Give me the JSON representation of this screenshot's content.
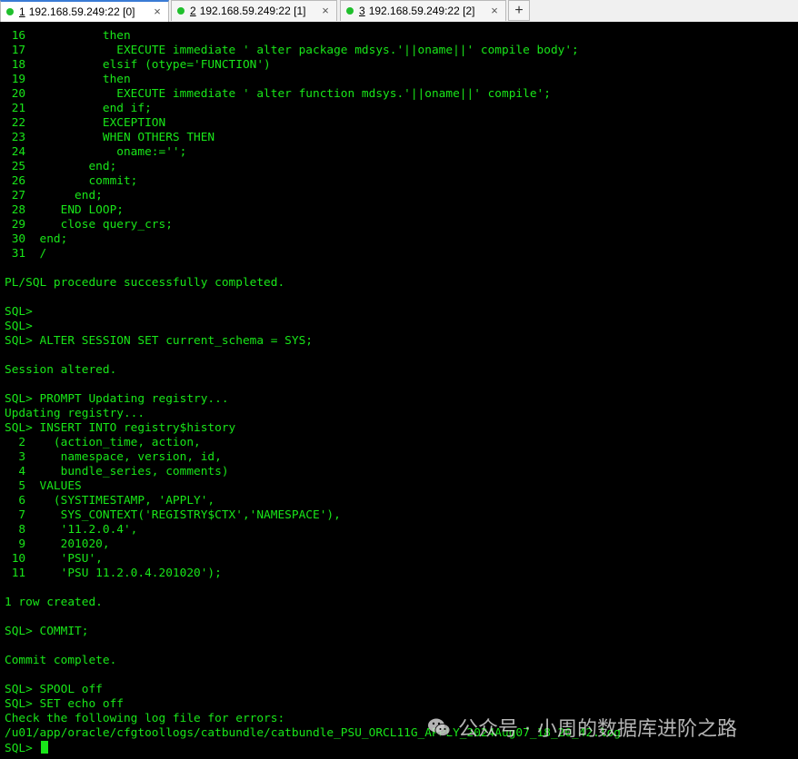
{
  "tabs": [
    {
      "num": "1",
      "label": "192.168.59.249:22 [0]",
      "active": true
    },
    {
      "num": "2",
      "label": "192.168.59.249:22 [1]",
      "active": false
    },
    {
      "num": "3",
      "label": "192.168.59.249:22 [2]",
      "active": false
    }
  ],
  "tab_add_label": "+",
  "tab_close_label": "×",
  "status_color": "#1fbf2c",
  "terminal": {
    "lines": [
      " 16           then",
      " 17             EXECUTE immediate ' alter package mdsys.'||oname||' compile body';",
      " 18           elsif (otype='FUNCTION')",
      " 19           then",
      " 20             EXECUTE immediate ' alter function mdsys.'||oname||' compile';",
      " 21           end if;",
      " 22           EXCEPTION",
      " 23           WHEN OTHERS THEN",
      " 24             oname:='';",
      " 25         end;",
      " 26         commit;",
      " 27       end;",
      " 28     END LOOP;",
      " 29     close query_crs;",
      " 30  end;",
      " 31  /",
      "",
      "PL/SQL procedure successfully completed.",
      "",
      "SQL>",
      "SQL>",
      "SQL> ALTER SESSION SET current_schema = SYS;",
      "",
      "Session altered.",
      "",
      "SQL> PROMPT Updating registry...",
      "Updating registry...",
      "SQL> INSERT INTO registry$history",
      "  2    (action_time, action,",
      "  3     namespace, version, id,",
      "  4     bundle_series, comments)",
      "  5  VALUES",
      "  6    (SYSTIMESTAMP, 'APPLY',",
      "  7     SYS_CONTEXT('REGISTRY$CTX','NAMESPACE'),",
      "  8     '11.2.0.4',",
      "  9     201020,",
      " 10     'PSU',",
      " 11     'PSU 11.2.0.4.201020');",
      "",
      "1 row created.",
      "",
      "SQL> COMMIT;",
      "",
      "Commit complete.",
      "",
      "SQL> SPOOL off",
      "SQL> SET echo off",
      "Check the following log file for errors:",
      "/u01/app/oracle/cfgtoollogs/catbundle/catbundle_PSU_ORCL11G_APPLY_2024Aug07_18_20_42.log"
    ],
    "prompt": "SQL> "
  },
  "watermark": {
    "text": "公众号 · 小周的数据库进阶之路"
  }
}
